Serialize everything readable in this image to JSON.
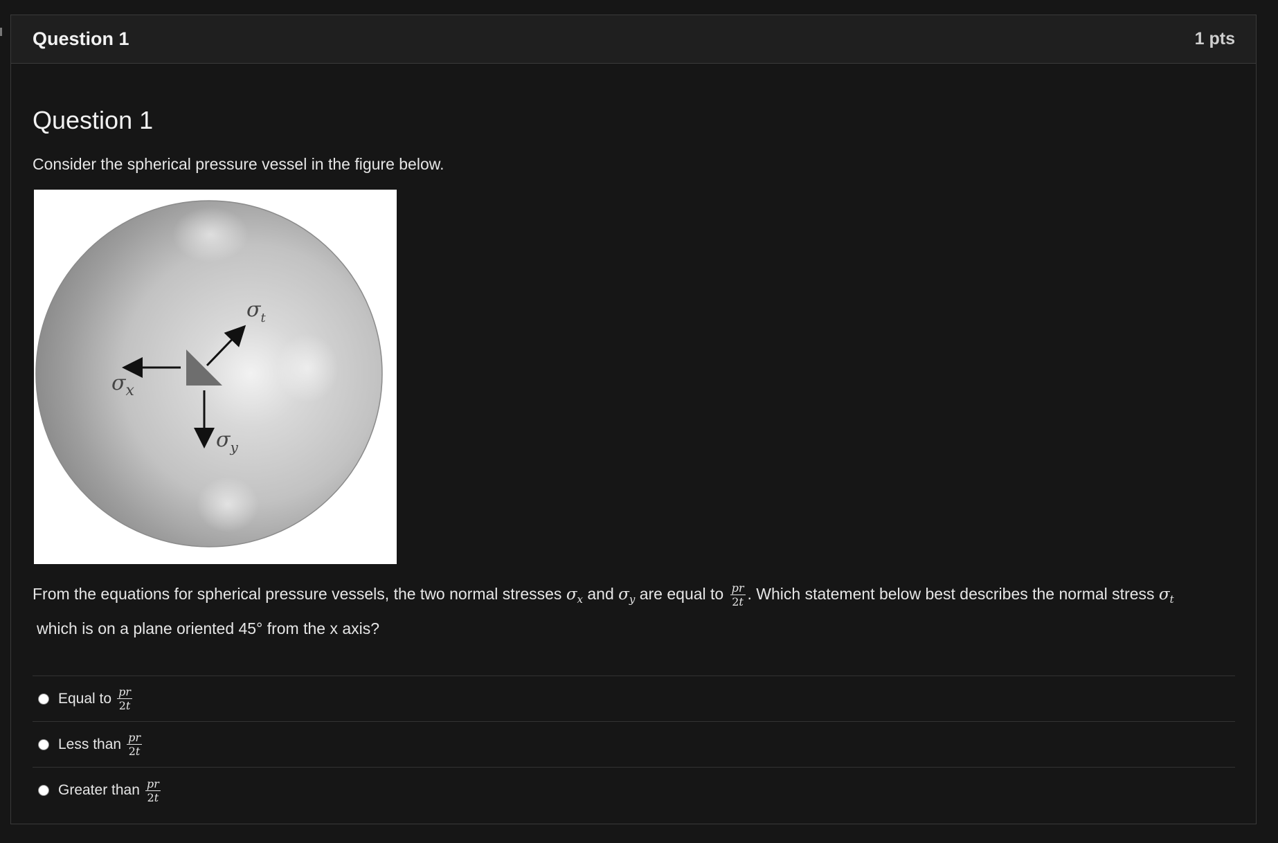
{
  "header": {
    "question_title": "Question 1",
    "points": "1 pts"
  },
  "body": {
    "heading": "Question 1",
    "intro": "Consider the spherical pressure vessel in the figure below.",
    "figure": {
      "labels": {
        "sigma_t": "σ",
        "sigma_t_sub": "t",
        "sigma_x": "σ",
        "sigma_x_sub": "x",
        "sigma_y": "σ",
        "sigma_y_sub": "y"
      }
    },
    "statement": {
      "part1": "From the equations for spherical pressure vessels, the two normal stresses ",
      "sx_symbol": "σ",
      "sx_sub": "x",
      "part2": " and ",
      "sy_symbol": "σ",
      "sy_sub": "y",
      "part3": " are equal to ",
      "frac_num": "pr",
      "frac_den_num": "2",
      "frac_den_var": "t",
      "part4": ". Which statement below best describes the normal stress ",
      "st_symbol": "σ",
      "st_sub": "t",
      "line2": "which is on a plane oriented 45° from the x axis?"
    },
    "answers": [
      {
        "label": "Equal to",
        "frac_num": "pr",
        "frac_den_num": "2",
        "frac_den_var": "t"
      },
      {
        "label": "Less than",
        "frac_num": "pr",
        "frac_den_num": "2",
        "frac_den_var": "t"
      },
      {
        "label": "Greater than",
        "frac_num": "pr",
        "frac_den_num": "2",
        "frac_den_var": "t"
      }
    ]
  },
  "colors": {
    "page_background": "#161616",
    "header_background": "#1f1f1f",
    "border": "#3a3a3a",
    "text": "#e6e6e6"
  }
}
